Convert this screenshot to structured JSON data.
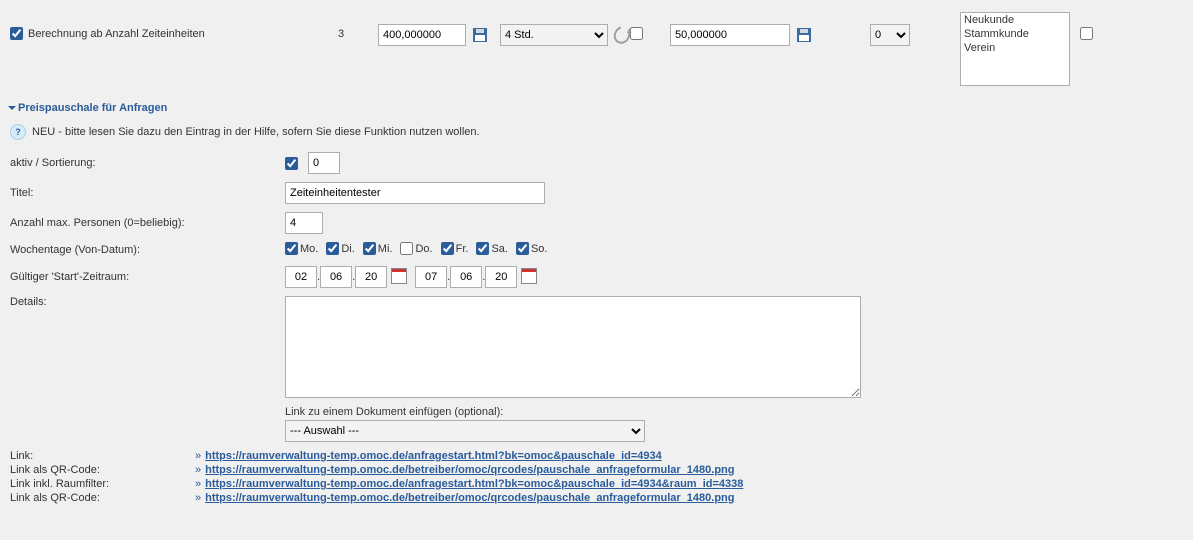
{
  "row1": {
    "checked": true,
    "label": "Berechnung ab Anzahl Zeiteinheiten",
    "qty": "3",
    "price1": "400,000000",
    "duration_sel": "4 Std.",
    "cb2": false,
    "price2": "50,000000",
    "num_sel": "0",
    "multi_opts": [
      "Neukunde",
      "Stammkunde",
      "Verein"
    ],
    "cb_end": false
  },
  "section_title": "Preispauschale für Anfragen",
  "tip": "NEU - bitte lesen Sie dazu den Eintrag in der Hilfe, sofern Sie diese Funktion nutzen wollen.",
  "form": {
    "aktiv_label": "aktiv / Sortierung:",
    "aktiv_checked": true,
    "aktiv_sort": "0",
    "titel_label": "Titel:",
    "titel_value": "Zeiteinheitentester",
    "max_pers_label": "Anzahl max. Personen (0=beliebig):",
    "max_pers_value": "4",
    "wochentage_label": "Wochentage (Von-Datum):",
    "days": [
      {
        "label": "Mo.",
        "checked": true
      },
      {
        "label": "Di.",
        "checked": true
      },
      {
        "label": "Mi.",
        "checked": true
      },
      {
        "label": "Do.",
        "checked": false
      },
      {
        "label": "Fr.",
        "checked": true
      },
      {
        "label": "Sa.",
        "checked": true
      },
      {
        "label": "So.",
        "checked": true
      }
    ],
    "gueltig_label": "Gültiger 'Start'-Zeitraum:",
    "date_from": {
      "d": "02",
      "m": "06",
      "y": "20"
    },
    "date_to": {
      "d": "07",
      "m": "06",
      "y": "20"
    },
    "details_label": "Details:",
    "details_value": "",
    "doc_link_label": "Link zu einem Dokument einfügen (optional):",
    "doc_link_sel": "--- Auswahl ---"
  },
  "links": [
    {
      "label": "Link:",
      "url": "https://raumverwaltung-temp.omoc.de/anfragestart.html?bk=omoc&pauschale_id=4934"
    },
    {
      "label": "Link als QR-Code:",
      "url": "https://raumverwaltung-temp.omoc.de/betreiber/omoc/qrcodes/pauschale_anfrageformular_1480.png"
    },
    {
      "label": "Link inkl. Raumfilter:",
      "url": "https://raumverwaltung-temp.omoc.de/anfragestart.html?bk=omoc&pauschale_id=4934&raum_id=4338"
    },
    {
      "label": "Link als QR-Code:",
      "url": "https://raumverwaltung-temp.omoc.de/betreiber/omoc/qrcodes/pauschale_anfrageformular_1480.png"
    }
  ]
}
